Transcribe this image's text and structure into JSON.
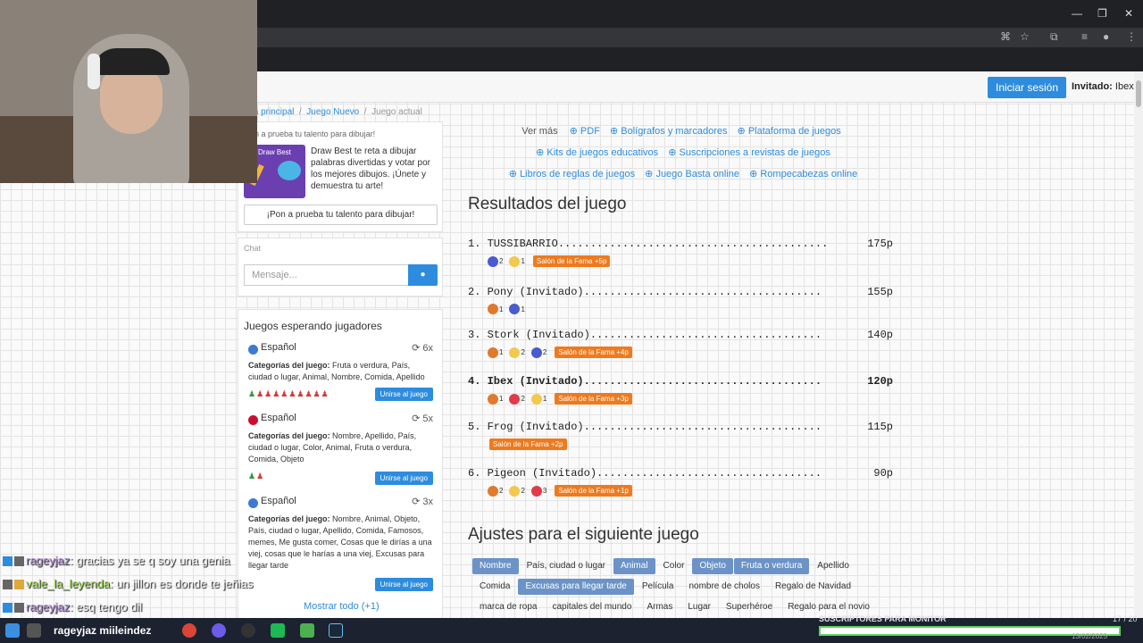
{
  "page": {
    "topbar": {
      "login_label": "Iniciar sesión",
      "guest_label": "Invitado:",
      "guest_name": "Ibex"
    },
    "breadcrumb": [
      "ina principal",
      "Juego Nuevo",
      "Juego actual"
    ],
    "promo": {
      "title": "on a prueba tu talento para dibujar!",
      "img_text": "Draw Best",
      "text": "Draw Best te reta a dibujar palabras divertidas y votar por los mejores dibujos. ¡Únete y demuestra tu arte!",
      "button": "¡Pon a prueba tu talento para dibujar!"
    },
    "chat": {
      "label": "Chat",
      "placeholder": "Mensaje..."
    },
    "waiting": {
      "heading": "Juegos esperando jugadores",
      "games": [
        {
          "lang": "Español",
          "count": "6x",
          "cats_label": "Categorías del juego:",
          "cats": "Fruta o verdura, País, ciudad o lugar, Animal, Nombre, Comida, Apellido",
          "players_green": "♟",
          "players_red": "♟♟♟♟♟♟♟♟♟",
          "join": "Unirse al juego",
          "flag": "#3b7bd4"
        },
        {
          "lang": "Español",
          "count": "5x",
          "cats_label": "Categorías del juego:",
          "cats": "Nombre, Apellido, País, ciudad o lugar, Color, Animal, Fruta o verdura, Comida, Objeto",
          "players_green": "♟",
          "players_red": "♟",
          "join": "Unirse al juego",
          "flag": "#c8102e"
        },
        {
          "lang": "Español",
          "count": "3x",
          "cats_label": "Categorías del juego:",
          "cats": "Nombre, Animal, Objeto, País, ciudad o lugar, Apellido, Comida, Famosos, memes, Me gusta comer, Cosas que le dirías a una viej, cosas que le harías a una viej, Excusas para llegar tarde",
          "join": "Unirse al juego",
          "flag": "#3b7bd4"
        }
      ],
      "show_all": "Mostrar todo (+1)"
    },
    "links": {
      "ver_mas": "Ver más",
      "row1": [
        "PDF",
        "Bolígrafos y marcadores",
        "Plataforma de juegos"
      ],
      "row2": [
        "Kits de juegos educativos",
        "Suscripciones a revistas de juegos"
      ],
      "row3": [
        "Libros de reglas de juegos",
        "Juego Basta online",
        "Rompecabezas online"
      ]
    },
    "results": {
      "heading": "Resultados del juego",
      "rows": [
        {
          "line": "1. TUSSIBARRIO..........................................",
          "pts": "175p",
          "bold": false,
          "votes": [
            {
              "type": "like",
              "n": "2"
            },
            {
              "type": "wow",
              "n": "1"
            }
          ],
          "fame": "Salón de la Fama +5p"
        },
        {
          "line": "2. Pony (Invitado).....................................",
          "pts": "155p",
          "bold": false,
          "votes": [
            {
              "type": "angry",
              "n": "1"
            },
            {
              "type": "like",
              "n": "1"
            }
          ],
          "fame": ""
        },
        {
          "line": "3. Stork (Invitado)....................................",
          "pts": "140p",
          "bold": false,
          "votes": [
            {
              "type": "angry",
              "n": "1"
            },
            {
              "type": "wow",
              "n": "2"
            },
            {
              "type": "like",
              "n": "2"
            }
          ],
          "fame": "Salón de la Fama +4p"
        },
        {
          "line": "4. Ibex (Invitado).....................................",
          "pts": "120p",
          "bold": true,
          "votes": [
            {
              "type": "angry",
              "n": "1"
            },
            {
              "type": "heart",
              "n": "2"
            },
            {
              "type": "wow",
              "n": "1"
            }
          ],
          "fame": "Salón de la Fama +3p"
        },
        {
          "line": "5. Frog (Invitado).....................................",
          "pts": "115p",
          "bold": false,
          "votes": [],
          "fame": "Salón de la Fama +2p"
        },
        {
          "line": "6. Pigeon (Invitado)...................................",
          "pts": "90p",
          "bold": false,
          "votes": [
            {
              "type": "angry",
              "n": "2"
            },
            {
              "type": "wow",
              "n": "2"
            },
            {
              "type": "heart",
              "n": "3"
            }
          ],
          "fame": "Salón de la Fama +1p"
        }
      ]
    },
    "settings": {
      "heading": "Ajustes para el siguiente juego",
      "rows": [
        [
          {
            "l": "Nombre",
            "on": true
          },
          {
            "l": "País, ciudad o lugar",
            "on": false
          },
          {
            "l": "Animal",
            "on": true
          },
          {
            "l": "Color",
            "on": false
          },
          {
            "l": "Objeto",
            "on": true
          },
          {
            "l": "Fruta o verdura",
            "on": true
          },
          {
            "l": "Apellido",
            "on": false
          }
        ],
        [
          {
            "l": "Comida",
            "on": false
          },
          {
            "l": "Excusas para llegar tarde",
            "on": true
          },
          {
            "l": "Película",
            "on": false
          },
          {
            "l": "nombre de cholos",
            "on": false
          },
          {
            "l": "Regalo de Navidad",
            "on": false
          }
        ],
        [
          {
            "l": "marca de ropa",
            "on": false
          },
          {
            "l": "capitales del mundo",
            "on": false
          },
          {
            "l": "Armas",
            "on": false
          },
          {
            "l": "Lugar",
            "on": false
          },
          {
            "l": "Superhéroe",
            "on": false
          },
          {
            "l": "Regalo para el novio",
            "on": false
          }
        ]
      ]
    }
  },
  "overlay": [
    {
      "name": "rageyjaz",
      "text": ": gracias ya se q soy una genia"
    },
    {
      "name": "vale_la_leyenda",
      "text": ": un jillon es donde te jeñias"
    },
    {
      "name": "rageyjaz",
      "text": ": esq tengo dil"
    }
  ],
  "taskbar": {
    "text": "rageyjaz miileindez",
    "sub_label": "SUSCRIPTORES PARA MONITOR",
    "sub_count": "17 / 20",
    "sub_progress": 0.91,
    "date": "13/02/2025"
  },
  "colors": {
    "accent": "#2d8cde",
    "fame": "#ef7a1e",
    "tag_on": "#6b93c7"
  }
}
